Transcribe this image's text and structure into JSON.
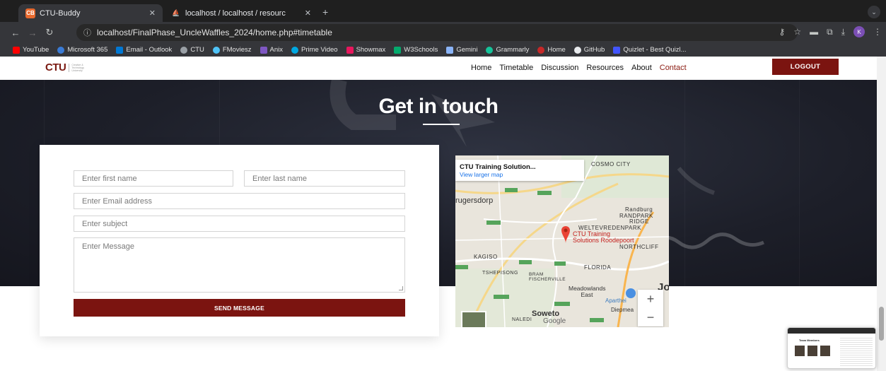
{
  "browser": {
    "tabs": [
      {
        "title": "CTU-Buddy",
        "favicon_text": "CB",
        "color": "#e86a2e"
      },
      {
        "title": "localhost / localhost / resourc",
        "favicon_text": "PMA",
        "color": "#f2a400"
      }
    ],
    "url": "localhost/FinalPhase_UncleWaffles_2024/home.php#timetable",
    "profile_initial": "K",
    "bookmarks": [
      {
        "label": "YouTube",
        "color": "#ff0000"
      },
      {
        "label": "Microsoft 365",
        "color": "#3a7bd5"
      },
      {
        "label": "Email - Outlook",
        "color": "#0078d4"
      },
      {
        "label": "CTU",
        "color": "#9aa0a6"
      },
      {
        "label": "FMoviesz",
        "color": "#4fc3f7"
      },
      {
        "label": "Anix",
        "color": "#7e57c2"
      },
      {
        "label": "Prime Video",
        "color": "#00a8e1"
      },
      {
        "label": "Showmax",
        "color": "#e8175d"
      },
      {
        "label": "W3Schools",
        "color": "#04aa6d"
      },
      {
        "label": "Gemini",
        "color": "#8ab4f8"
      },
      {
        "label": "Grammarly",
        "color": "#15c39a"
      },
      {
        "label": "Home",
        "color": "#c62828"
      },
      {
        "label": "GitHub",
        "color": "#e8eaed"
      },
      {
        "label": "Quizlet - Best Quizl...",
        "color": "#4255ff"
      }
    ]
  },
  "site": {
    "logo": {
      "mark": "CTU",
      "sub": "Creative & Technology University"
    },
    "nav": [
      "Home",
      "Timetable",
      "Discussion",
      "Resources",
      "About",
      "Contact"
    ],
    "active_nav": "Contact",
    "logout_label": "LOGOUT",
    "accent_color": "#7b1410"
  },
  "hero": {
    "title": "Get in touch"
  },
  "form": {
    "first_name_placeholder": "Enter first name",
    "last_name_placeholder": "Enter last name",
    "email_placeholder": "Enter Email address",
    "subject_placeholder": "Enter subject",
    "message_placeholder": "Enter Message",
    "send_label": "SEND MESSAGE"
  },
  "map": {
    "place_title": "CTU Training Solution...",
    "larger_map_link": "View larger map",
    "pin_label_1": "CTU Training",
    "pin_label_2": "Solutions Roodepoort",
    "labels": {
      "cosmo_city": "COSMO CITY",
      "krugersdorp": "rugersdorp",
      "randburg": "Randburg",
      "randpark": "RANDPARK",
      "ridge": "RIDGE",
      "weltevredenpark": "WELTEVREDENPARK",
      "northcliff": "NORTHCLIFF",
      "kagiso": "KAGISO",
      "florida": "FLORIDA",
      "tshepisong": "TSHEPISONG",
      "bram_fischerville": "BRAM FISCHERVILLE",
      "meadowlands": "Meadowlands East",
      "apartheid": "Aparthei",
      "diepmeadow": "Diepmea",
      "soweto": "Soweto",
      "naledi": "NALEDI",
      "jo": "Jo",
      "google": "Google"
    },
    "zoom_in": "+",
    "zoom_out": "−"
  },
  "pip": {
    "title": "Team Members"
  }
}
